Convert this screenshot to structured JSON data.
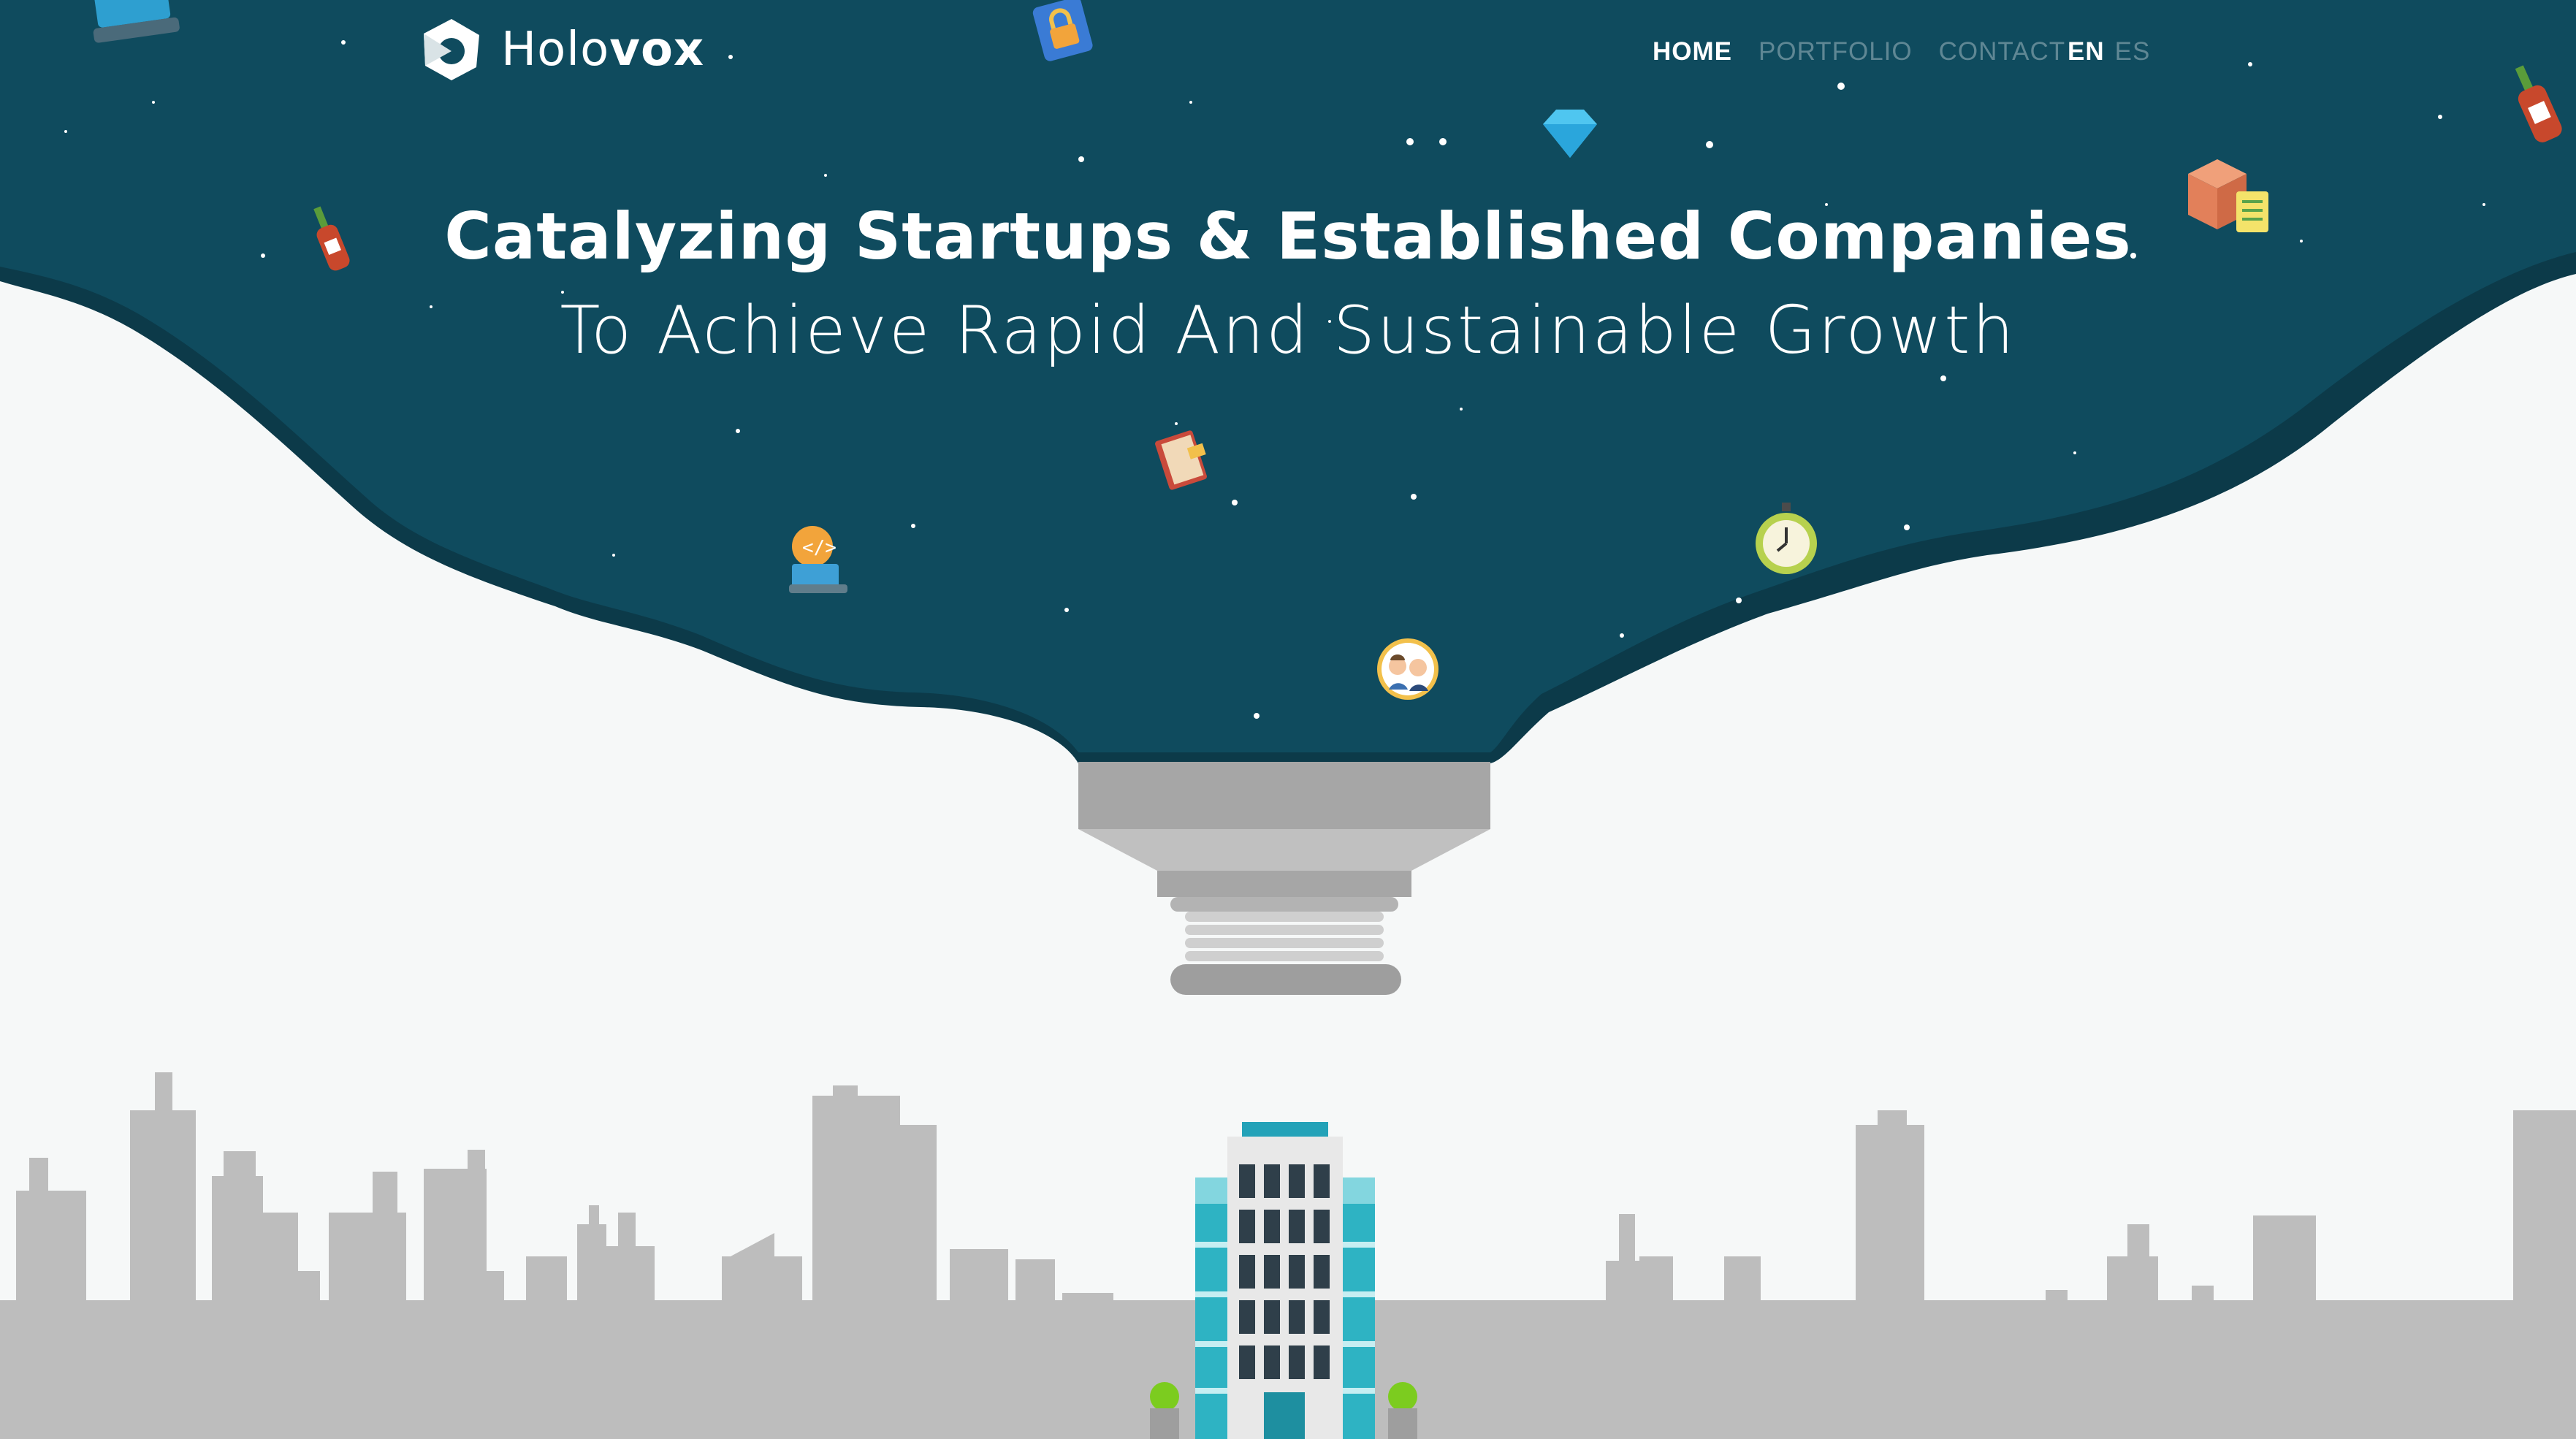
{
  "brand": {
    "name_part1": "Holo",
    "name_part2": "vox"
  },
  "nav": {
    "items": [
      {
        "label": "HOME",
        "active": true
      },
      {
        "label": "PORTFOLIO",
        "active": false
      },
      {
        "label": "CONTACT",
        "active": false
      }
    ],
    "languages": [
      {
        "label": "EN",
        "active": true
      },
      {
        "label": "ES",
        "active": false
      }
    ]
  },
  "hero": {
    "title": "Catalyzing Startups & Established Companies",
    "subtitle": "To Achieve Rapid And Sustainable Growth"
  },
  "colors": {
    "sky": "#0f4a5c",
    "sky_edge": "#0c3a49",
    "page_bg": "#f6f8f8",
    "skyline": "#bdbdbd",
    "building_teal": "#2eb3c3",
    "nav_inactive": "#5f8794",
    "tree_green": "#7ccc1f"
  },
  "floating_icons": [
    "laptop-icon",
    "lock-icon",
    "diamond-icon",
    "hot-sauce-icon",
    "box-checklist-icon",
    "book-icon",
    "code-laptop-icon",
    "stopwatch-icon",
    "team-avatar-icon",
    "hot-sauce-icon-right"
  ]
}
